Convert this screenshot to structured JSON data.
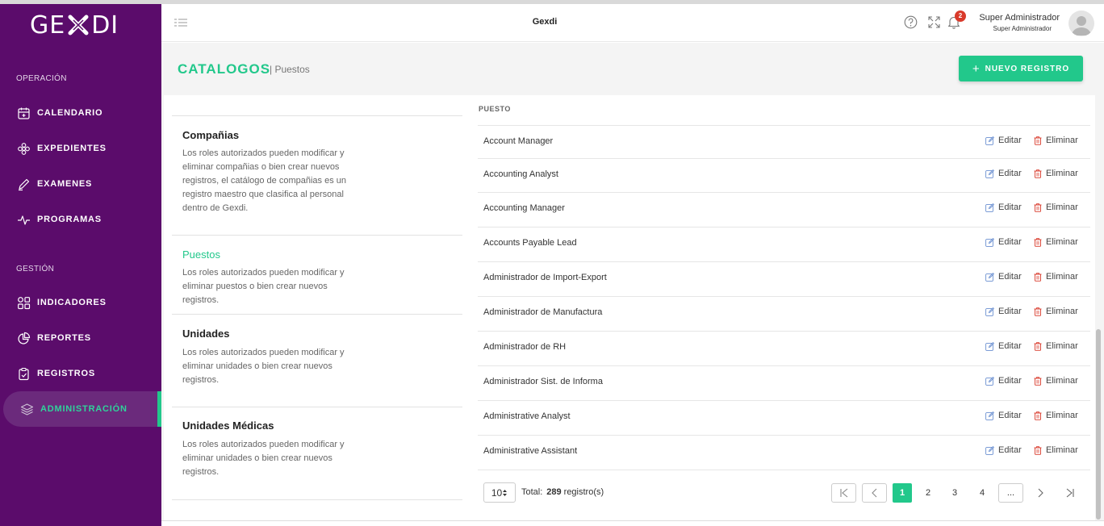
{
  "app": {
    "logo_text_left": "GE",
    "logo_text_right": "DI",
    "title": "Gexdi"
  },
  "sidebar": {
    "section_operacion": "OPERACIÓN",
    "section_gestion": "GESTIÓN",
    "items": [
      {
        "label": "CALENDARIO",
        "icon": "calendar-icon"
      },
      {
        "label": "EXPEDIENTES",
        "icon": "flower-icon"
      },
      {
        "label": "EXAMENES",
        "icon": "pencil-icon"
      },
      {
        "label": "PROGRAMAS",
        "icon": "pulse-icon"
      },
      {
        "label": "INDICADORES",
        "icon": "grid-icon"
      },
      {
        "label": "REPORTES",
        "icon": "pie-chart-icon"
      },
      {
        "label": "REGISTROS",
        "icon": "clipboard-icon"
      },
      {
        "label": "ADMINISTRACIÓN",
        "icon": "layers-icon",
        "active": true
      }
    ]
  },
  "topbar": {
    "notifications_count": "2",
    "user_name": "Super Administrador",
    "user_role": "Super Administrador"
  },
  "header": {
    "title": "CATALOGOS",
    "subtitle": "| Puestos",
    "new_button": "NUEVO REGISTRO"
  },
  "catalogs": [
    {
      "title": "Compañias",
      "desc": "Los roles autorizados pueden modificar y eliminar compañias o bien crear nuevos registros, el catálogo de compañias es un registro maestro que clasifica al personal dentro de Gexdi."
    },
    {
      "title": "Puestos",
      "desc": "Los roles autorizados pueden modificar y eliminar puestos o bien crear nuevos registros.",
      "active": true
    },
    {
      "title": "Unidades",
      "desc": "Los roles autorizados pueden modificar y eliminar unidades o bien crear nuevos registros."
    },
    {
      "title": "Unidades Médicas",
      "desc": "Los roles autorizados pueden modificar y eliminar unidades o bien crear nuevos registros."
    }
  ],
  "table": {
    "column_header": "PUESTO",
    "edit_label": "Editar",
    "delete_label": "Eliminar",
    "rows": [
      "Account Manager",
      "Accounting Analyst",
      "Accounting Manager",
      "Accounts Payable Lead",
      "Administrador de Import-Export",
      "Administrador de Manufactura",
      "Administrador de RH",
      "Administrador Sist. de Informa",
      "Administrative Analyst",
      "Administrative Assistant"
    ]
  },
  "pagination": {
    "page_size": "10",
    "total_label": "Total:",
    "total_count": "289",
    "total_suffix": "registro(s)",
    "pages": [
      "1",
      "2",
      "3",
      "4"
    ],
    "ellipsis": "...",
    "current_page": "1"
  },
  "colors": {
    "sidebar": "#5b0c6b",
    "accent": "#22c88b",
    "danger": "#d93a2b"
  }
}
